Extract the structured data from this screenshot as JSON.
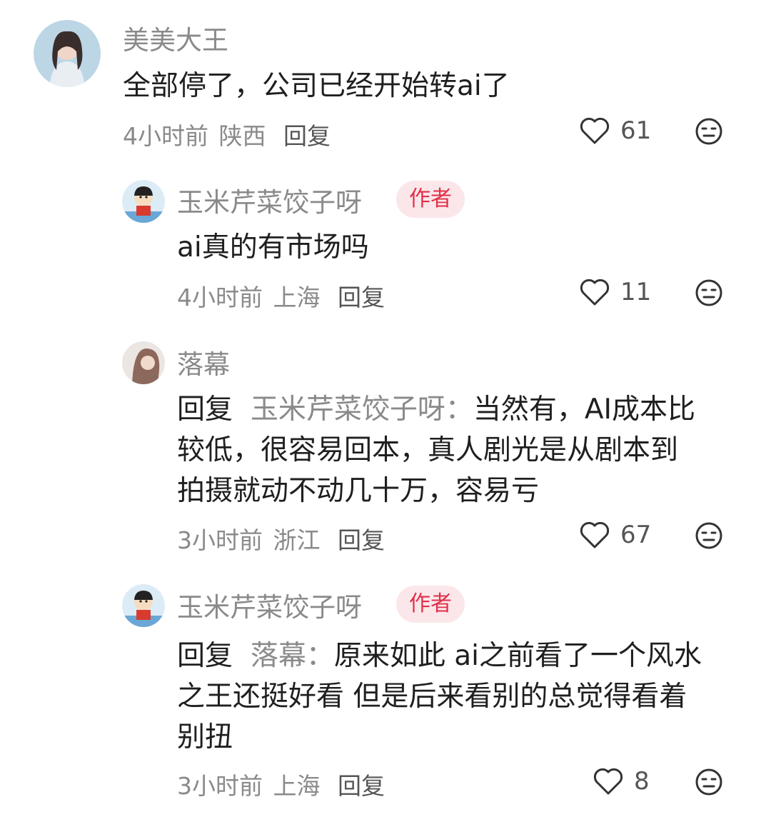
{
  "comments": [
    {
      "username": "美美大王",
      "text": "全部停了，公司已经开始转ai了",
      "time": "4小时前",
      "location": "陕西",
      "reply_label": "回复",
      "likes": "61"
    },
    {
      "username": "玉米芹菜饺子呀",
      "badge": "作者",
      "text": "ai真的有市场吗",
      "time": "4小时前",
      "location": "上海",
      "reply_label": "回复",
      "likes": "11"
    },
    {
      "username": "落幕",
      "reply_prefix": "回复",
      "reply_to": "玉米芹菜饺子呀：",
      "text_lines": [
        "当然有，AI成本比",
        "较低，很容易回本，真人剧光是从剧本到",
        "拍摄就动不动几十万，容易亏"
      ],
      "time": "3小时前",
      "location": "浙江",
      "reply_label": "回复",
      "likes": "67"
    },
    {
      "username": "玉米芹菜饺子呀",
      "badge": "作者",
      "reply_prefix": "回复",
      "reply_to": "落幕：",
      "text_lines": [
        "原来如此 ai之前看了一个风水",
        "之王还挺好看 但是后来看别的总觉得看着",
        "别扭"
      ],
      "time": "3小时前",
      "location": "上海",
      "reply_label": "回复",
      "likes": "8"
    }
  ],
  "colors": {
    "secondary": "#8a8a8a",
    "badge_text": "#e0304a",
    "badge_bg": "#fbe7ea"
  }
}
